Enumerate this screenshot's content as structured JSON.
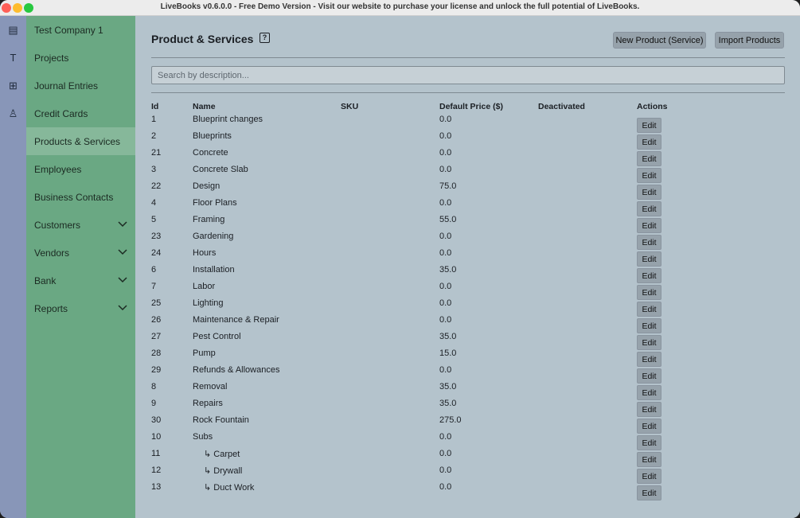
{
  "window": {
    "title": "LiveBooks v0.6.0.0 - Free Demo Version - Visit our website to purchase your license and unlock the full potential of LiveBooks."
  },
  "iconbar": {
    "items": [
      {
        "icon": "building-icon",
        "glyph": "▤"
      },
      {
        "icon": "t-icon",
        "glyph": "T"
      },
      {
        "icon": "plus-square-icon",
        "glyph": "⊞"
      },
      {
        "icon": "user-icon",
        "glyph": "♙"
      }
    ]
  },
  "sidebar": {
    "company": "Test Company 1",
    "items": [
      {
        "label": "Projects"
      },
      {
        "label": "Journal Entries"
      },
      {
        "label": "Credit Cards"
      },
      {
        "label": "Products & Services",
        "active": true
      },
      {
        "label": "Employees"
      },
      {
        "label": "Business Contacts"
      },
      {
        "label": "Customers",
        "expandable": true
      },
      {
        "label": "Vendors",
        "expandable": true
      },
      {
        "label": "Bank",
        "expandable": true
      },
      {
        "label": "Reports",
        "expandable": true
      }
    ]
  },
  "main": {
    "title": "Product & Services",
    "help_glyph": "?",
    "new_button": "New Product (Service)",
    "import_button": "Import Products",
    "search_placeholder": "Search by description...",
    "columns": {
      "id": "Id",
      "name": "Name",
      "sku": "SKU",
      "price": "Default Price ($)",
      "deactivated": "Deactivated",
      "actions": "Actions"
    },
    "edit_label": "Edit",
    "rows": [
      {
        "id": "1",
        "name": "Blueprint changes",
        "price": "0.0"
      },
      {
        "id": "2",
        "name": "Blueprints",
        "price": "0.0"
      },
      {
        "id": "21",
        "name": "Concrete",
        "price": "0.0"
      },
      {
        "id": "3",
        "name": "Concrete Slab",
        "price": "0.0"
      },
      {
        "id": "22",
        "name": "Design",
        "price": "75.0"
      },
      {
        "id": "4",
        "name": "Floor Plans",
        "price": "0.0"
      },
      {
        "id": "5",
        "name": "Framing",
        "price": "55.0"
      },
      {
        "id": "23",
        "name": "Gardening",
        "price": "0.0"
      },
      {
        "id": "24",
        "name": "Hours",
        "price": "0.0"
      },
      {
        "id": "6",
        "name": "Installation",
        "price": "35.0"
      },
      {
        "id": "7",
        "name": "Labor",
        "price": "0.0"
      },
      {
        "id": "25",
        "name": "Lighting",
        "price": "0.0"
      },
      {
        "id": "26",
        "name": "Maintenance & Repair",
        "price": "0.0"
      },
      {
        "id": "27",
        "name": "Pest Control",
        "price": "35.0"
      },
      {
        "id": "28",
        "name": "Pump",
        "price": "15.0"
      },
      {
        "id": "29",
        "name": "Refunds & Allowances",
        "price": "0.0"
      },
      {
        "id": "8",
        "name": "Removal",
        "price": "35.0"
      },
      {
        "id": "9",
        "name": "Repairs",
        "price": "35.0"
      },
      {
        "id": "30",
        "name": "Rock Fountain",
        "price": "275.0"
      },
      {
        "id": "10",
        "name": "Subs",
        "price": "0.0"
      },
      {
        "id": "11",
        "name": "↳ Carpet",
        "price": "0.0",
        "child": true
      },
      {
        "id": "12",
        "name": "↳ Drywall",
        "price": "0.0",
        "child": true
      },
      {
        "id": "13",
        "name": "↳ Duct Work",
        "price": "0.0",
        "child": true
      }
    ]
  }
}
